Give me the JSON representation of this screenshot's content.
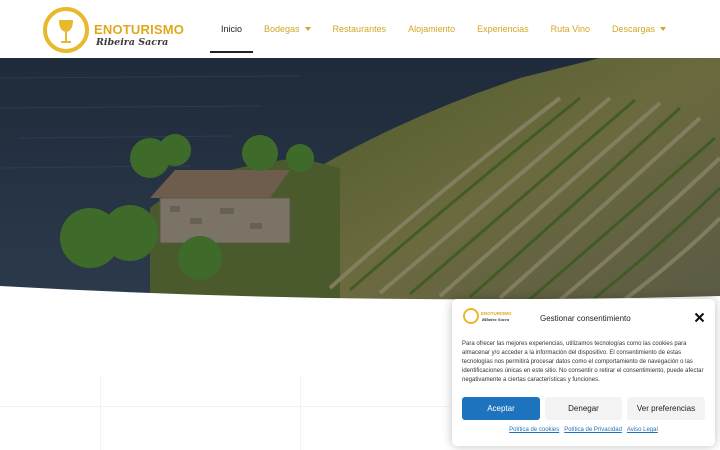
{
  "brand": {
    "title": "ENOTURISMO",
    "subtitle": "Ribeira Sacra"
  },
  "nav": {
    "items": [
      {
        "label": "Inicio",
        "active": true,
        "dropdown": false
      },
      {
        "label": "Bodegas",
        "active": false,
        "dropdown": true
      },
      {
        "label": "Restaurantes",
        "active": false,
        "dropdown": false
      },
      {
        "label": "Alojamiento",
        "active": false,
        "dropdown": false
      },
      {
        "label": "Experiencias",
        "active": false,
        "dropdown": false
      },
      {
        "label": "Ruta Vino",
        "active": false,
        "dropdown": false
      },
      {
        "label": "Descargas",
        "active": false,
        "dropdown": true
      }
    ]
  },
  "consent": {
    "logo_title": "ENOTURISMO",
    "logo_subtitle": "Ribeira Sacra",
    "title": "Gestionar consentimiento",
    "body": "Para ofrecer las mejores experiencias, utilizamos tecnologías como las cookies para almacenar y/o acceder a la información del dispositivo. El consentimiento de estas tecnologías nos permitirá procesar datos como el comportamiento de navegación o las identificaciones únicas en este sitio. No consentir o retirar el consentimiento, puede afectar negativamente a ciertas características y funciones.",
    "accept_label": "Aceptar",
    "deny_label": "Denegar",
    "prefs_label": "Ver preferencias",
    "links": {
      "cookies": "Política de cookies",
      "privacy": "Política de Privacidad",
      "legal": "Aviso Legal"
    }
  },
  "colors": {
    "brand_gold": "#e0a81c",
    "accent_blue": "#1e73be"
  }
}
